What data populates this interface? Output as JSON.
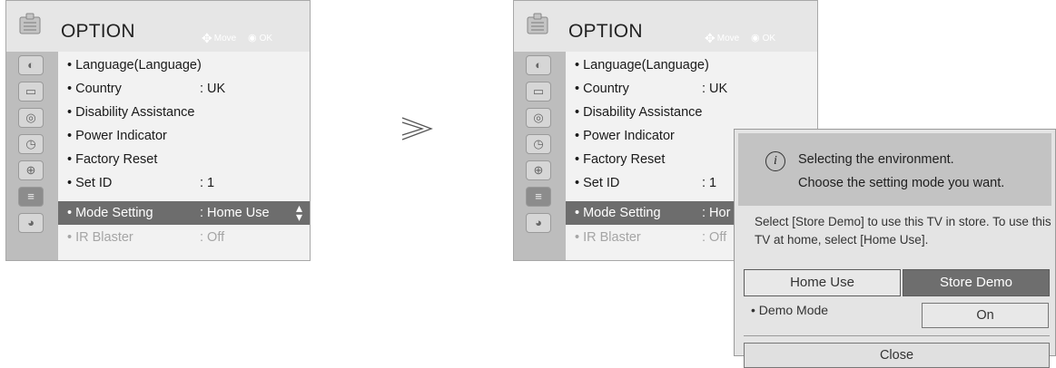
{
  "menu": {
    "title": "OPTION",
    "hint_move": "Move",
    "hint_ok": "OK",
    "items": [
      {
        "label": "• Language(Language)",
        "value": ""
      },
      {
        "label": "• Country",
        "value": ": UK"
      },
      {
        "label": "• Disability Assistance",
        "value": ""
      },
      {
        "label": "• Power Indicator",
        "value": ""
      },
      {
        "label": "• Factory Reset",
        "value": ""
      },
      {
        "label": "• Set ID",
        "value": ": 1"
      },
      {
        "label": "• Mode Setting",
        "value": ": Home Use"
      },
      {
        "label": "• IR Blaster",
        "value": ": Off"
      }
    ]
  },
  "menu2": {
    "truncated_mode_value": ": Hor"
  },
  "dialog": {
    "info_line1": "Selecting the environment.",
    "info_line2": "Choose the setting mode you want.",
    "description": "Select [Store Demo] to use this TV in store. To use this TV at home, select [Home Use].",
    "home_use_label": "Home Use",
    "store_demo_label": "Store Demo",
    "demo_mode_label": "• Demo Mode",
    "demo_mode_value": "On",
    "close_label": "Close"
  },
  "icons": {
    "header": "option-icon",
    "sidebar": [
      "picture-icon",
      "screen-icon",
      "audio-icon",
      "time-icon",
      "lock-icon",
      "option-icon",
      "network-icon"
    ],
    "arrow": "next-step-arrow-icon",
    "info": "info-icon"
  },
  "colors": {
    "selected_row": "#6d6d6d",
    "store_demo_button": "#6e6e6e",
    "menu_header": "#e6e6e6"
  }
}
